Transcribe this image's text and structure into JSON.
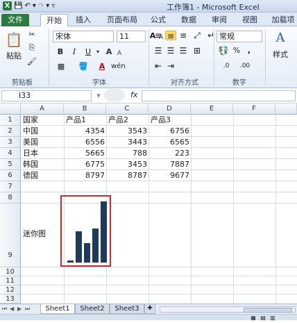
{
  "window": {
    "title": "工作簿1 - Microsoft Excel"
  },
  "ribbon_tabs": [
    "文件",
    "开始",
    "插入",
    "页面布局",
    "公式",
    "数据",
    "审阅",
    "视图",
    "加载项"
  ],
  "clipboard": {
    "paste": "粘贴",
    "label": "剪贴板"
  },
  "font": {
    "name": "宋体",
    "size": "11",
    "label": "字体",
    "bold": "B",
    "italic": "I",
    "underline": "U",
    "grow": "A",
    "shrink": "A",
    "color": "A"
  },
  "alignment": {
    "label": "对齐方式"
  },
  "number": {
    "format": "常规",
    "label": "数字",
    "percent": "%",
    "comma": ",",
    "inc": ".0",
    "dec": ".00"
  },
  "styles": {
    "label": "样式"
  },
  "formula_bar": {
    "name_box": "I33",
    "fx": "fx",
    "value": ""
  },
  "columns": [
    "A",
    "B",
    "C",
    "D",
    "E",
    "F"
  ],
  "rows": [
    "1",
    "2",
    "3",
    "4",
    "5",
    "6",
    "7",
    "8",
    "9",
    "10",
    "11",
    "12",
    "13"
  ],
  "table": {
    "header": [
      "国家",
      "产品1",
      "产品2",
      "产品3"
    ],
    "rows": [
      [
        "中国",
        "4354",
        "3543",
        "6756"
      ],
      [
        "美国",
        "6556",
        "3443",
        "6565"
      ],
      [
        "日本",
        "5665",
        "788",
        "223"
      ],
      [
        "韩国",
        "6775",
        "3453",
        "7887"
      ],
      [
        "德国",
        "8797",
        "8787",
        "9677"
      ]
    ]
  },
  "sparkline_label": "迷你图",
  "chart_data": {
    "type": "bar",
    "categories": [
      "中国",
      "美国",
      "日本",
      "韩国",
      "德国"
    ],
    "values": [
      4354,
      6556,
      5665,
      6775,
      8797
    ],
    "title": "",
    "xlabel": "",
    "ylabel": "",
    "ylim": [
      4200,
      8797
    ]
  },
  "sheets": [
    "Sheet1",
    "Sheet2",
    "Sheet3"
  ],
  "colors": {
    "file_tab": "#2c7a3f",
    "sparkline": "#1f3a5c",
    "highlight_box": "#d7262b"
  }
}
